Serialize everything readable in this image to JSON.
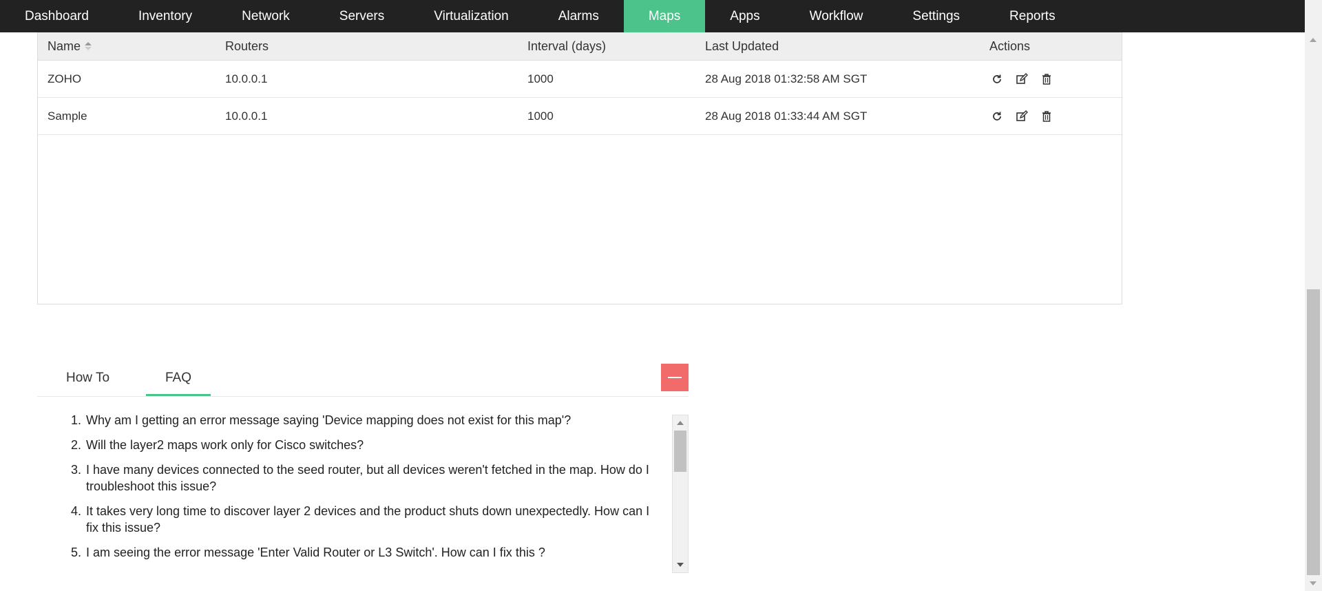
{
  "nav": {
    "items": [
      {
        "label": "Dashboard"
      },
      {
        "label": "Inventory"
      },
      {
        "label": "Network"
      },
      {
        "label": "Servers"
      },
      {
        "label": "Virtualization"
      },
      {
        "label": "Alarms"
      },
      {
        "label": "Maps",
        "active": true
      },
      {
        "label": "Apps"
      },
      {
        "label": "Workflow"
      },
      {
        "label": "Settings"
      },
      {
        "label": "Reports"
      }
    ]
  },
  "table": {
    "columns": [
      "Name",
      "Routers",
      "Interval (days)",
      "Last Updated",
      "Actions"
    ],
    "sorted_column": "Name",
    "rows": [
      {
        "name": "ZOHO",
        "routers": "10.0.0.1",
        "interval": "1000",
        "last_updated": "28 Aug 2018 01:32:58 AM SGT"
      },
      {
        "name": "Sample",
        "routers": "10.0.0.1",
        "interval": "1000",
        "last_updated": "28 Aug 2018 01:33:44 AM SGT"
      }
    ],
    "actions": [
      "refresh-icon",
      "edit-icon",
      "delete-icon"
    ]
  },
  "help": {
    "tabs": [
      {
        "label": "How To"
      },
      {
        "label": "FAQ",
        "active": true
      }
    ],
    "faq": [
      "Why am I getting an error message saying 'Device mapping does not exist for this map'?",
      "Will the layer2 maps work only for Cisco switches?",
      "I have many devices connected to the seed router, but all devices weren't fetched in the map. How do I troubleshoot this issue?",
      "It takes very long time to discover layer 2 devices and the product shuts down unexpectedly. How can I fix this issue?",
      "I am seeing the error message 'Enter Valid Router or L3 Switch'. How can I fix this ?"
    ]
  },
  "colors": {
    "nav_bg": "#222222",
    "accent": "#4cc38a",
    "collapse_button": "#f26b6b"
  }
}
